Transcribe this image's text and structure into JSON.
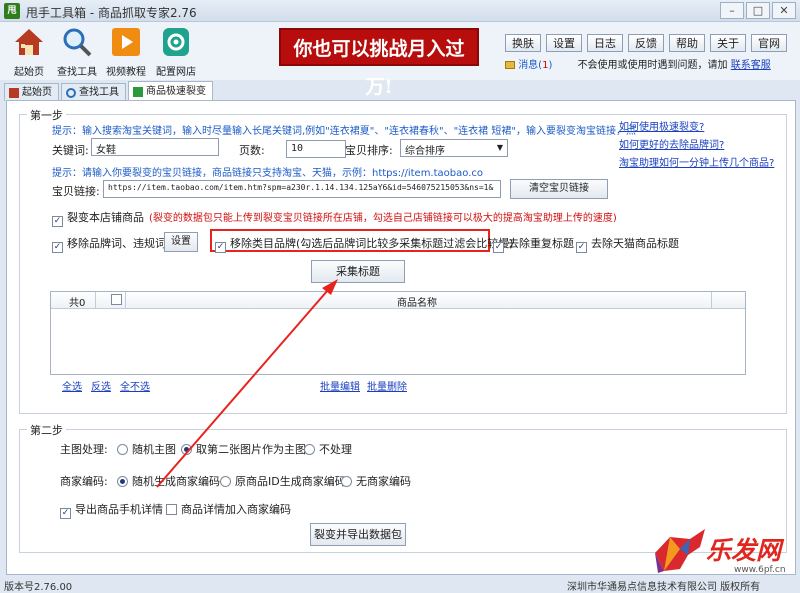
{
  "window": {
    "icon_text": "甩",
    "title": "甩手工具箱 - 商品抓取专家2.76"
  },
  "toolbar": {
    "items": [
      {
        "label": "起始页"
      },
      {
        "label": "查找工具"
      },
      {
        "label": "视频教程"
      },
      {
        "label": "配置网店"
      }
    ]
  },
  "banner": {
    "text": "你也可以挑战月入过万!"
  },
  "top_buttons": [
    "换肤",
    "设置",
    "日志",
    "反馈",
    "帮助",
    "关于",
    "官网"
  ],
  "message": {
    "label": "消息(",
    "count": "1",
    "label_end": ")",
    "notice": "不会使用或使用时遇到问题，请加",
    "link": "联系客服"
  },
  "tabs": [
    "起始页",
    "查找工具",
    "商品极速裂变"
  ],
  "step1": {
    "title": "第一步",
    "hint1": "提示：输入搜索淘宝关键词，输入时尽量输入长尾关键词,例如\"连衣裙夏\"、\"连衣裙春秋\"、\"连衣裙 短裙\"，输入要裂变淘宝链接，点",
    "help_links": [
      "如何使用极速裂变?",
      "如何更好的去除品牌词?",
      "淘宝助理如何一分钟上传几个商品?"
    ],
    "keyword_label": "关键词:",
    "keyword_value": "女鞋",
    "pages_label": "页数:",
    "pages_value": "10",
    "sort_label": "宝贝排序:",
    "sort_value": "综合排序",
    "hint2": "提示：请输入你要裂变的宝贝链接，商品链接只支持淘宝、天猫，示例：https://item.taobao.co",
    "link_label": "宝贝链接:",
    "link_value": "https://item.taobao.com/item.htm?spm=a230r.1.14.134.125aY6&id=546075215053&ns=1&",
    "clear_button": "清空宝贝链接",
    "store_checkbox": "裂变本店铺商品",
    "store_note": "(裂变的数据包只能上传到裂变宝贝链接所在店铺，勾选自己店铺链接可以极大的提高淘宝助理上传的速度)",
    "remove_brand": "移除品牌词、违规词",
    "settings_button": "设置",
    "remove_category": "移除类目品牌(勾选后品牌词比较多采集标题过滤会比较慢)",
    "dedupe": "去除重复标题",
    "remove_tmall": "去除天猫商品标题",
    "collect_button": "采集标题"
  },
  "table": {
    "count_label": "共0",
    "column": "商品名称"
  },
  "table_actions": {
    "select_all": "全选",
    "invert": "反选",
    "select_none": "全不选",
    "batch_edit": "批量编辑",
    "batch_delete": "批量删除"
  },
  "step2": {
    "title": "第二步",
    "main_image_label": "主图处理:",
    "main_image_options": [
      "随机主图",
      "取第二张图片作为主图",
      "不处理"
    ],
    "merchant_label": "商家编码:",
    "merchant_options": [
      "随机生成商家编码",
      "原商品ID生成商家编码",
      "无商家编码"
    ],
    "export_mobile": "导出商品手机详情",
    "add_code": "商品详情加入商家编码",
    "export_button": "裂变并导出数据包"
  },
  "status": {
    "version": "版本号2.76.00",
    "copyright": "深圳市华通易点信息技术有限公司 版权所有"
  },
  "watermark": {
    "brand": "乐发网",
    "url": "www.6pf.cn"
  }
}
